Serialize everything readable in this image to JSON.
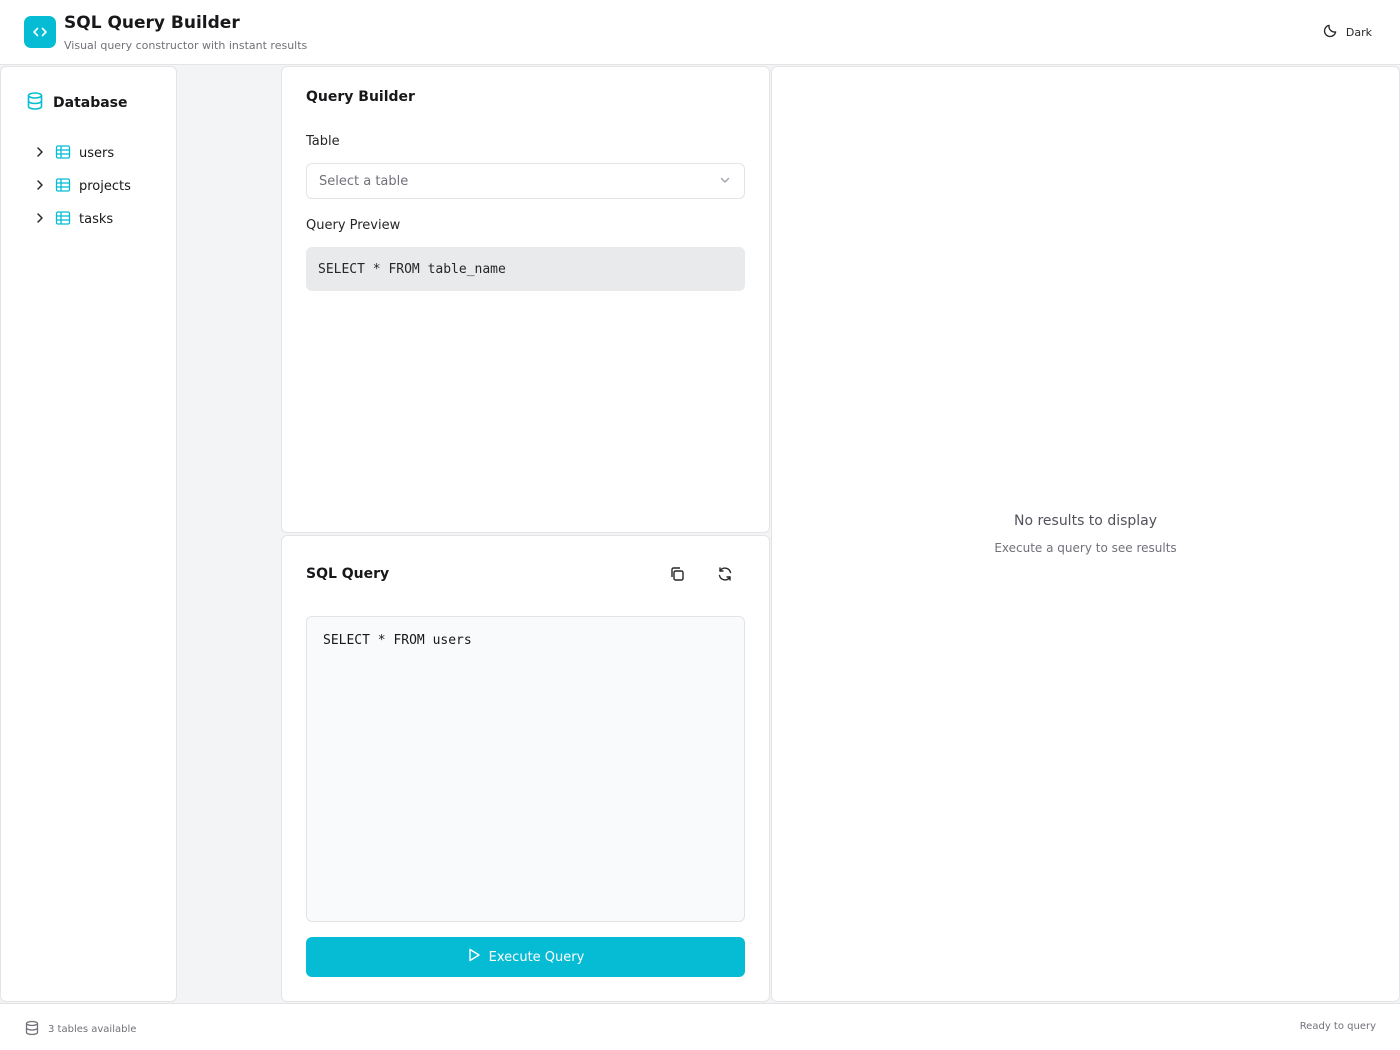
{
  "app": {
    "title": "SQL Query Builder",
    "subtitle": "Visual query constructor with instant results",
    "logo_icon": "code-brackets-icon",
    "accent_color": "#06bcd4"
  },
  "header": {
    "theme_toggle_label": "Dark",
    "theme_icon": "moon-icon"
  },
  "sidebar": {
    "title": "Database",
    "icon": "database-icon",
    "tables": [
      {
        "name": "users",
        "icon": "table-icon"
      },
      {
        "name": "projects",
        "icon": "table-icon"
      },
      {
        "name": "tasks",
        "icon": "table-icon"
      }
    ]
  },
  "builder": {
    "title": "Query Builder",
    "table_label": "Table",
    "table_select_placeholder": "Select a table",
    "preview_label": "Query Preview",
    "preview_query": "SELECT * FROM table_name"
  },
  "sql_panel": {
    "title": "SQL Query",
    "copy_icon": "copy-icon",
    "refresh_icon": "refresh-icon",
    "query": "SELECT * FROM users",
    "execute_label": "Execute Query",
    "execute_icon": "play-icon"
  },
  "results": {
    "empty_title": "No results to display",
    "empty_subtitle": "Execute a query to see results"
  },
  "footer": {
    "tables_count_text": "3 tables available",
    "status_text": "Ready to query"
  }
}
